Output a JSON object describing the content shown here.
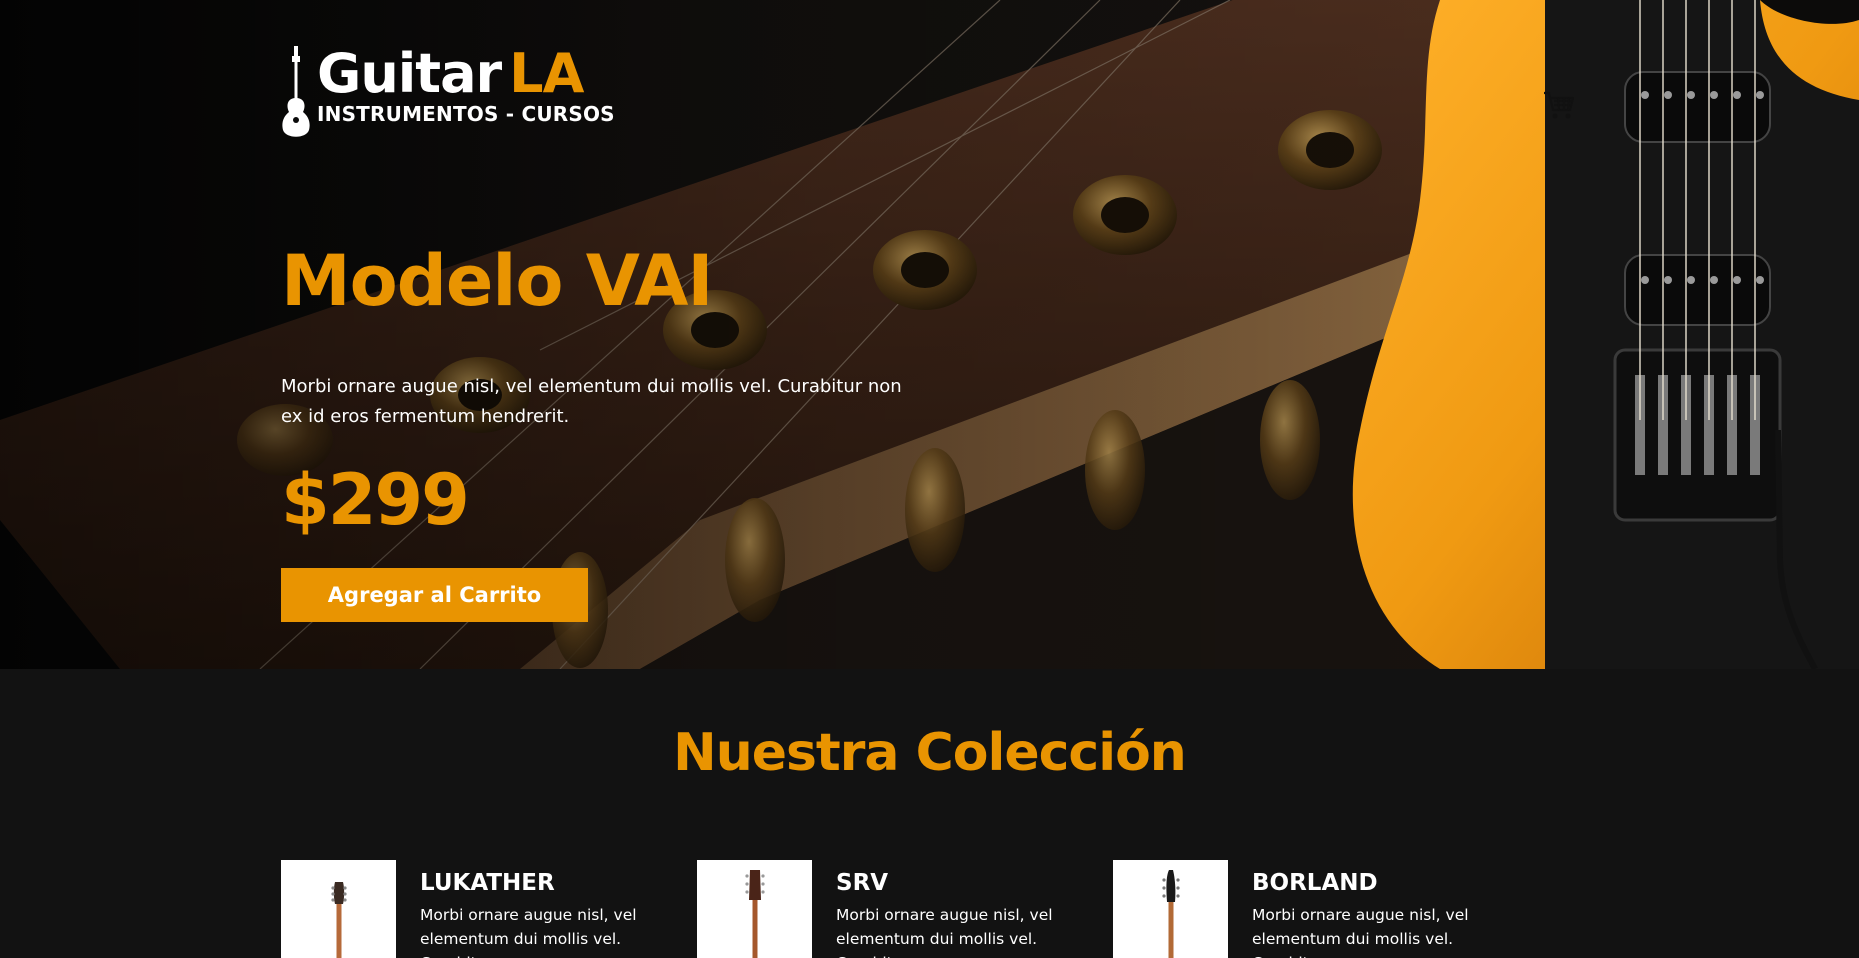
{
  "header": {
    "logo_primary": "Guitar",
    "logo_accent": "LA",
    "logo_tagline": "INSTRUMENTOS - CURSOS",
    "cart_icon": "cart-icon"
  },
  "hero": {
    "title": "Modelo VAI",
    "description": "Morbi ornare augue nisl, vel elementum dui mollis vel. Curabitur non ex id eros fermentum hendrerit.",
    "price": "$299",
    "button_label": "Agregar al Carrito"
  },
  "collection": {
    "title": "Nuestra Colección",
    "products": [
      {
        "name": "LUKATHER",
        "description": "Morbi ornare augue nisl, vel elementum dui mollis vel. Curabitur"
      },
      {
        "name": "SRV",
        "description": "Morbi ornare augue nisl, vel elementum dui mollis vel. Curabitur"
      },
      {
        "name": "BORLAND",
        "description": "Morbi ornare augue nisl, vel elementum dui mollis vel. Curabitur"
      }
    ]
  },
  "colors": {
    "accent": "#e99401",
    "background": "#121212",
    "text": "#ffffff"
  }
}
